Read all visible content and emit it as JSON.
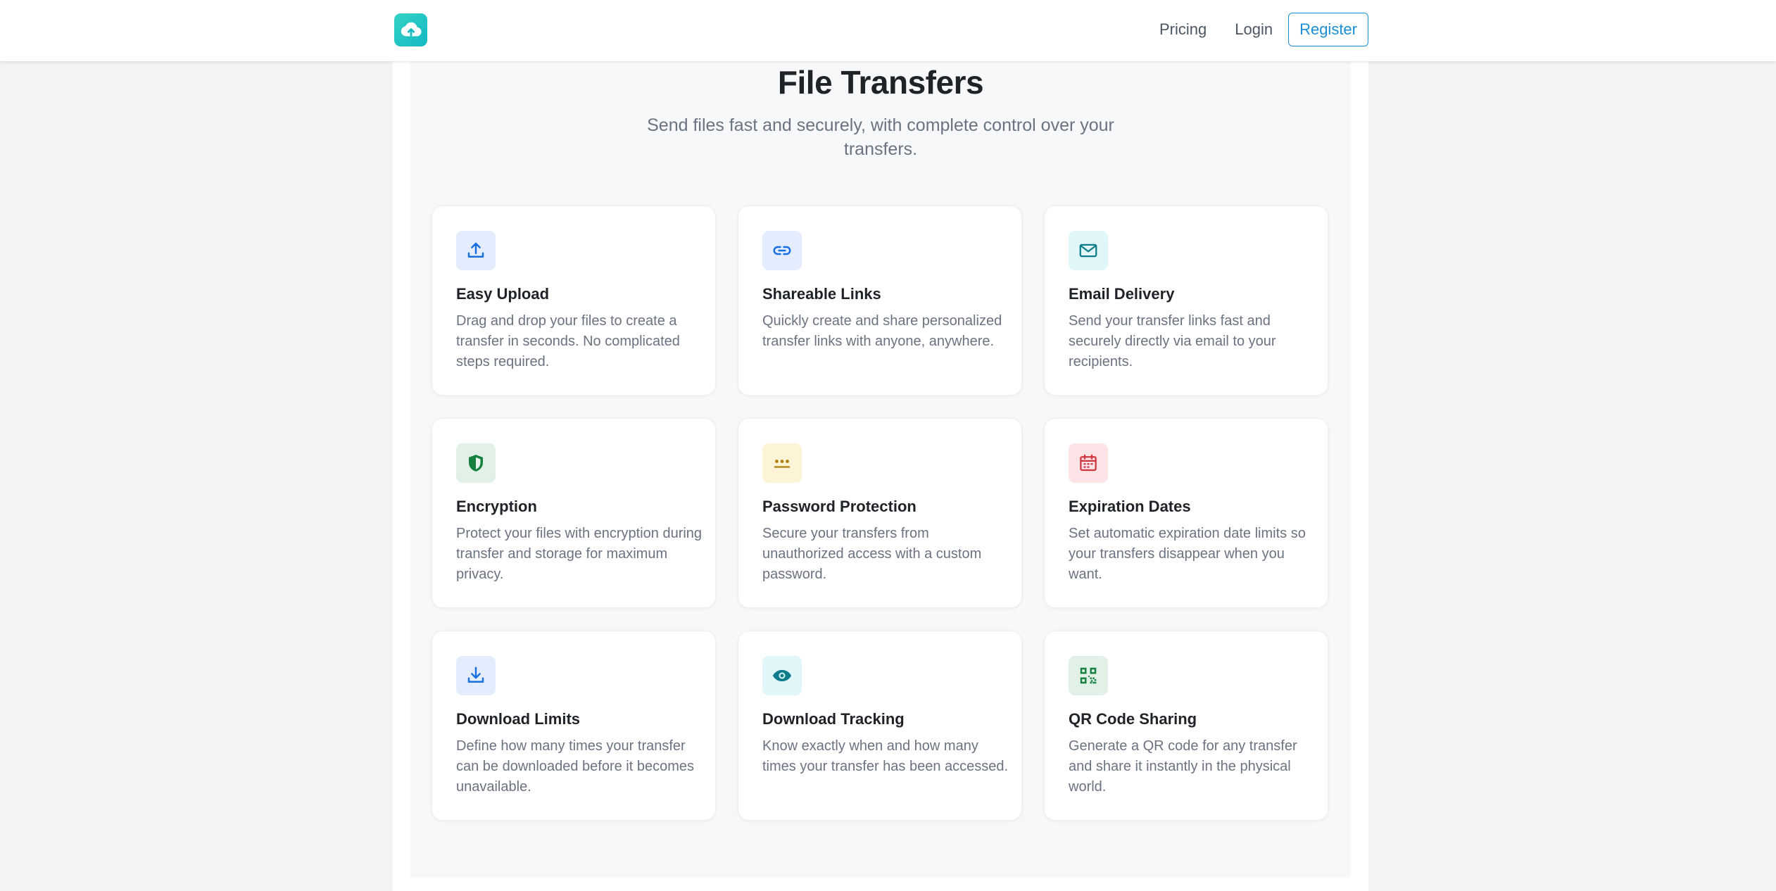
{
  "nav": {
    "logo_icon": "cloud-upload-icon",
    "links": [
      "Pricing",
      "Login"
    ],
    "register_label": "Register",
    "accent": "#1b8fd6"
  },
  "hero": {
    "title": "File Transfers",
    "subtitle": "Send files fast and securely, with complete control over your transfers."
  },
  "features": [
    {
      "icon": "upload-icon",
      "icon_bg": "#e3edfd",
      "icon_color": "#1a6fe0",
      "title": "Easy Upload",
      "text": "Drag and drop your files to create a transfer in seconds. No complicated steps required."
    },
    {
      "icon": "link-icon",
      "icon_bg": "#e3edfd",
      "icon_color": "#1a6fe0",
      "title": "Shareable Links",
      "text": "Quickly create and share personalized transfer links with anyone, anywhere."
    },
    {
      "icon": "mail-icon",
      "icon_bg": "#e0f6f8",
      "icon_color": "#0e7c8a",
      "title": "Email Delivery",
      "text": "Send your transfer links fast and securely directly via email to your recipients."
    },
    {
      "icon": "shield-icon",
      "icon_bg": "#e2f1e8",
      "icon_color": "#17823f",
      "title": "Encryption",
      "text": "Protect your files with encryption during transfer and storage for maximum privacy."
    },
    {
      "icon": "password-dots-icon",
      "icon_bg": "#fdf3d6",
      "icon_color": "#b07d0b",
      "title": "Password Protection",
      "text": "Secure your transfers from unauthorized access with a custom password."
    },
    {
      "icon": "calendar-icon",
      "icon_bg": "#fce4e6",
      "icon_color": "#d0343e",
      "title": "Expiration Dates",
      "text": "Set automatic expiration date limits so your transfers disappear when you want."
    },
    {
      "icon": "download-icon",
      "icon_bg": "#e3edfd",
      "icon_color": "#1a6fe0",
      "title": "Download Limits",
      "text": "Define how many times your transfer can be downloaded before it becomes unavailable."
    },
    {
      "icon": "eye-icon",
      "icon_bg": "#e0f6f8",
      "icon_color": "#0e7c8a",
      "title": "Download Tracking",
      "text": "Know exactly when and how many times your transfer has been accessed."
    },
    {
      "icon": "qr-code-icon",
      "icon_bg": "#e2f1e8",
      "icon_color": "#17823f",
      "title": "QR Code Sharing",
      "text": "Generate a QR code for any transfer and share it instantly in the physical world."
    }
  ]
}
